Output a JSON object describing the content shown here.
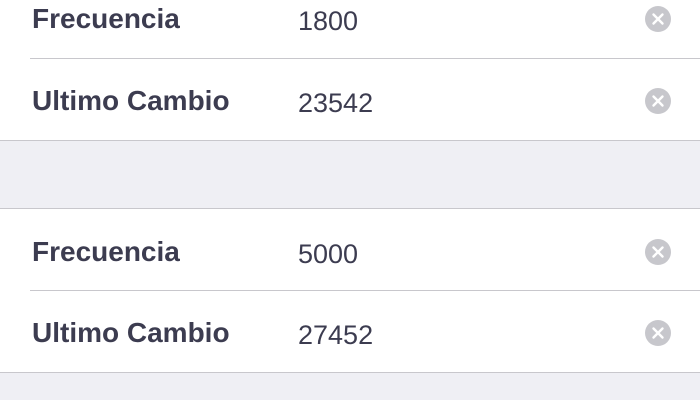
{
  "sections": [
    {
      "rows": [
        {
          "label": "Frecuencia",
          "value": "1800"
        },
        {
          "label": "Ultimo Cambio",
          "value": "23542"
        }
      ]
    },
    {
      "rows": [
        {
          "label": "Frecuencia",
          "value": "5000"
        },
        {
          "label": "Ultimo Cambio",
          "value": "27452"
        }
      ]
    }
  ],
  "icons": {
    "clear": "clear-icon"
  },
  "colors": {
    "background": "#efeff4",
    "cell": "#ffffff",
    "text": "#3c3c50",
    "separator": "#c8c7cc",
    "clear_button": "#c7c7cc"
  }
}
